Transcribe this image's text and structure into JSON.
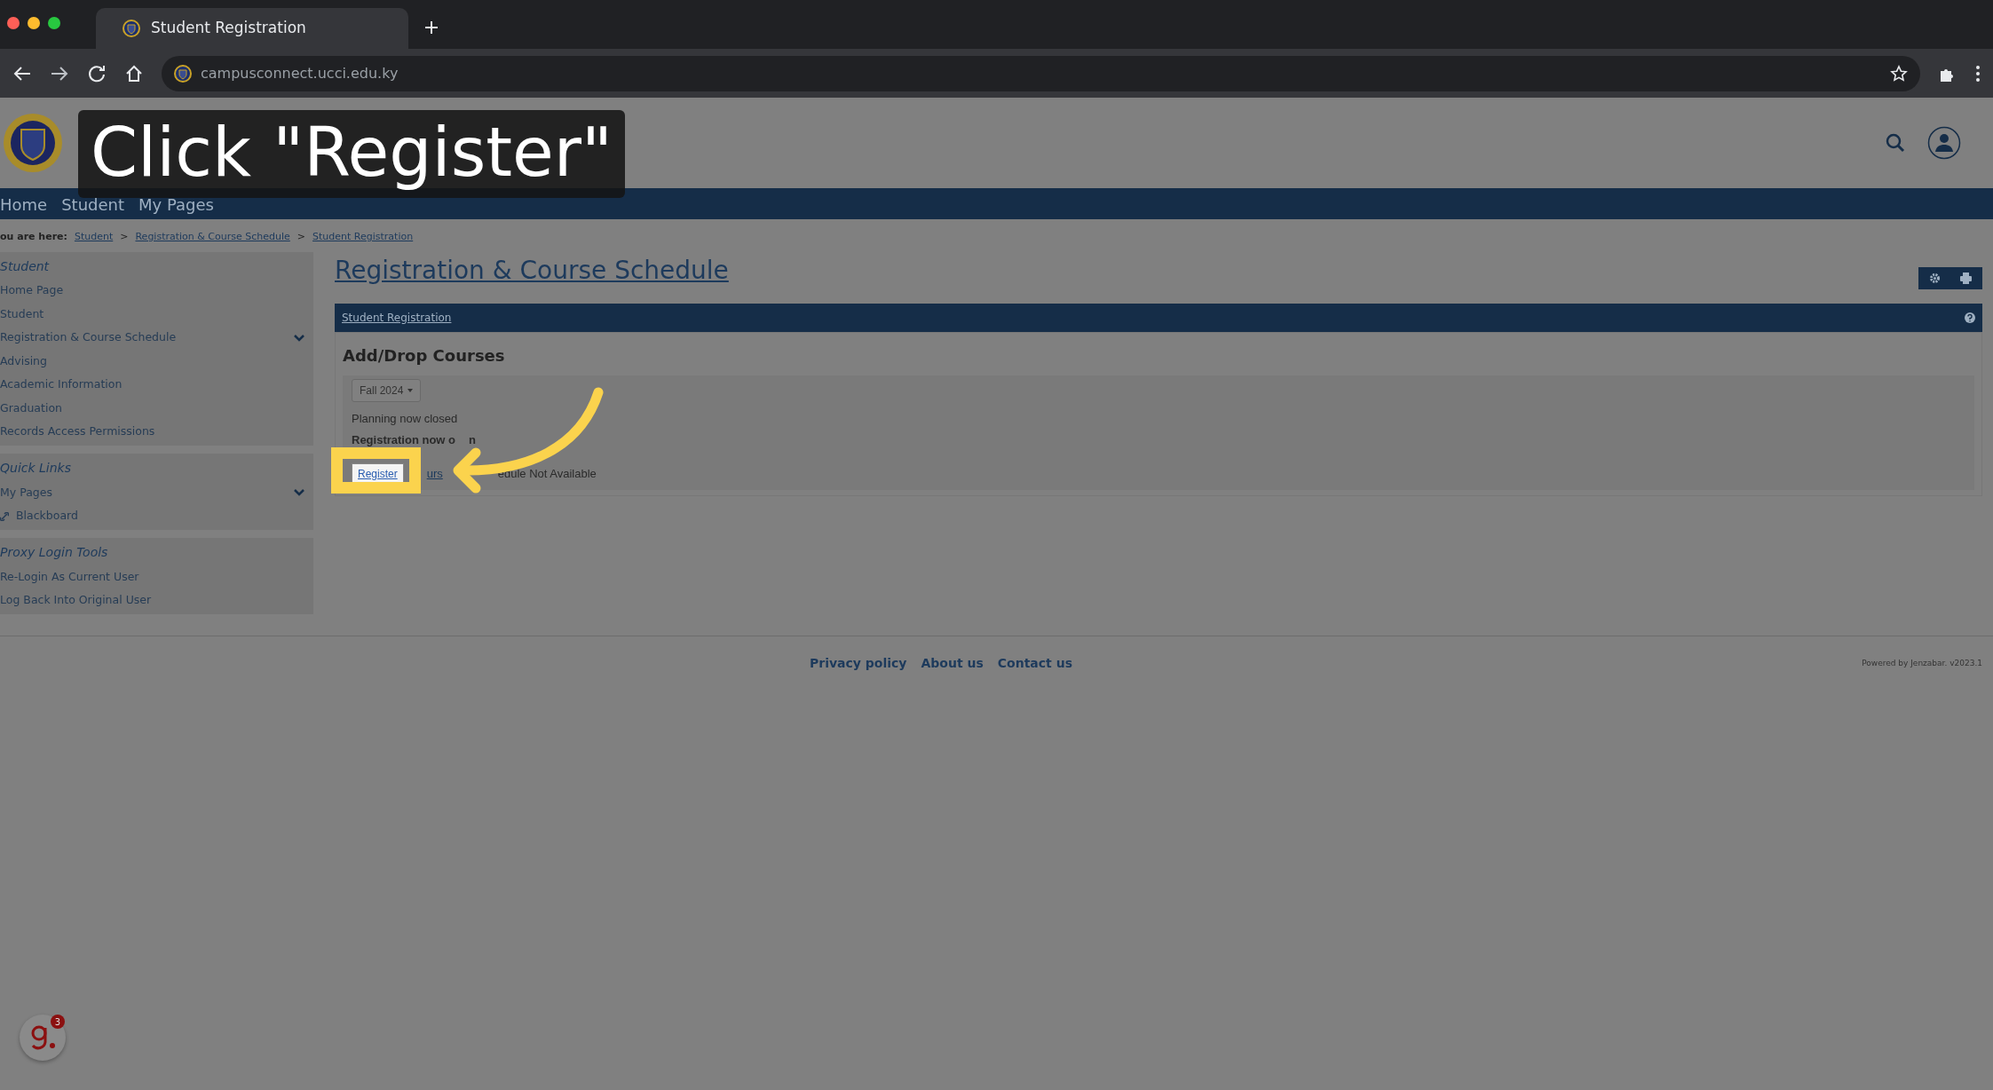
{
  "browser": {
    "tab_title": "Student Registration",
    "url": "campusconnect.ucci.edu.ky"
  },
  "nav": [
    "Home",
    "Student",
    "My Pages"
  ],
  "breadcrumb": {
    "label": "ou are here:",
    "links": [
      "Student",
      "Registration & Course Schedule",
      "Student Registration"
    ],
    "separator": ">"
  },
  "sidebar": [
    {
      "title": "Student",
      "items": [
        {
          "label": "Home Page",
          "kind": "page"
        },
        {
          "label": "Student",
          "kind": "page"
        },
        {
          "label": "Registration & Course Schedule",
          "kind": "submenu"
        },
        {
          "label": "Advising",
          "kind": "page"
        },
        {
          "label": "Academic Information",
          "kind": "page"
        },
        {
          "label": "Graduation",
          "kind": "page"
        },
        {
          "label": "Records Access Permissions",
          "kind": "page"
        }
      ]
    },
    {
      "title": "Quick Links",
      "items": [
        {
          "label": "My Pages",
          "kind": "submenu"
        },
        {
          "label": "Blackboard",
          "kind": "link"
        }
      ]
    },
    {
      "title": "Proxy Login Tools",
      "items": [
        {
          "label": "Re-Login As Current User",
          "kind": "page"
        },
        {
          "label": "Log Back Into Original User",
          "kind": "page"
        }
      ]
    }
  ],
  "main": {
    "title": "Registration & Course Schedule",
    "portlet_title": "Student Registration",
    "heading": "Add/Drop Courses",
    "term": "Fall 2024",
    "planning_status": "Planning now closed",
    "registration_status": [
      "Registration now o",
      "n"
    ],
    "register_button": "Register",
    "search_link_fragment": "urs",
    "schedule_fragment": "edule Not Available"
  },
  "tutorial": {
    "caption": "Click \"Register\""
  },
  "footer": {
    "links": [
      "Privacy policy",
      "About us",
      "Contact us"
    ],
    "powered_by": "Powered by Jenzabar. v2023.1"
  },
  "assistant_badge": {
    "count": "3"
  }
}
